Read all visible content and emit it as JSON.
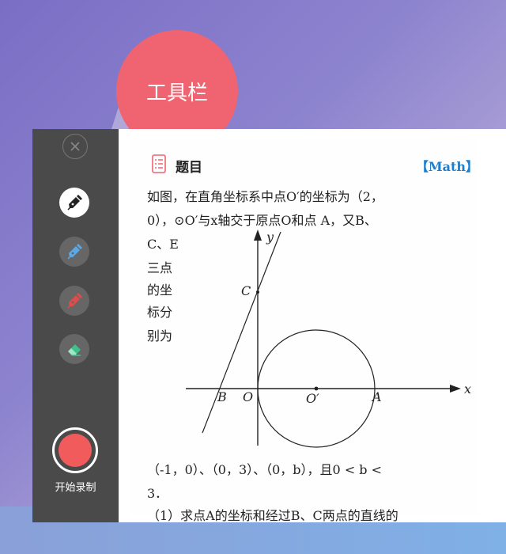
{
  "toolbar": {
    "record_label": "开始录制",
    "tools": [
      {
        "name": "close",
        "icon": "close-icon"
      },
      {
        "name": "black-pen",
        "icon": "pen-icon",
        "color": "#222222"
      },
      {
        "name": "blue-pen",
        "icon": "pen-icon",
        "color": "#5aa8e6"
      },
      {
        "name": "red-pen",
        "icon": "pen-icon",
        "color": "#e24b4b"
      },
      {
        "name": "eraser",
        "icon": "eraser-icon",
        "color": "#3ec28c"
      }
    ]
  },
  "callout": {
    "label": "工具栏"
  },
  "question": {
    "header": "题目",
    "tag": "【Math】",
    "lines": [
      "如图，在直角坐标系中点O′的坐标为（2，",
      "0），⊙O′与x轴交于原点O和点 A，又B、",
      "C、E",
      "三点",
      "的坐",
      "标分",
      "别为",
      "（-1，0）、（0，3）、（0，b），且0 < b <",
      "3．",
      "（1）求点A的坐标和经过B、C两点的直线的"
    ],
    "figure_labels": {
      "y": "y",
      "x": "x",
      "c": "C",
      "b": "B",
      "o": "O",
      "o_prime": "O′",
      "a": "A"
    }
  },
  "colors": {
    "bubble": "#ef6470",
    "toolbar_bg": "#4a4a4a",
    "record": "#f25b5b",
    "tag": "#1a7fd0"
  }
}
